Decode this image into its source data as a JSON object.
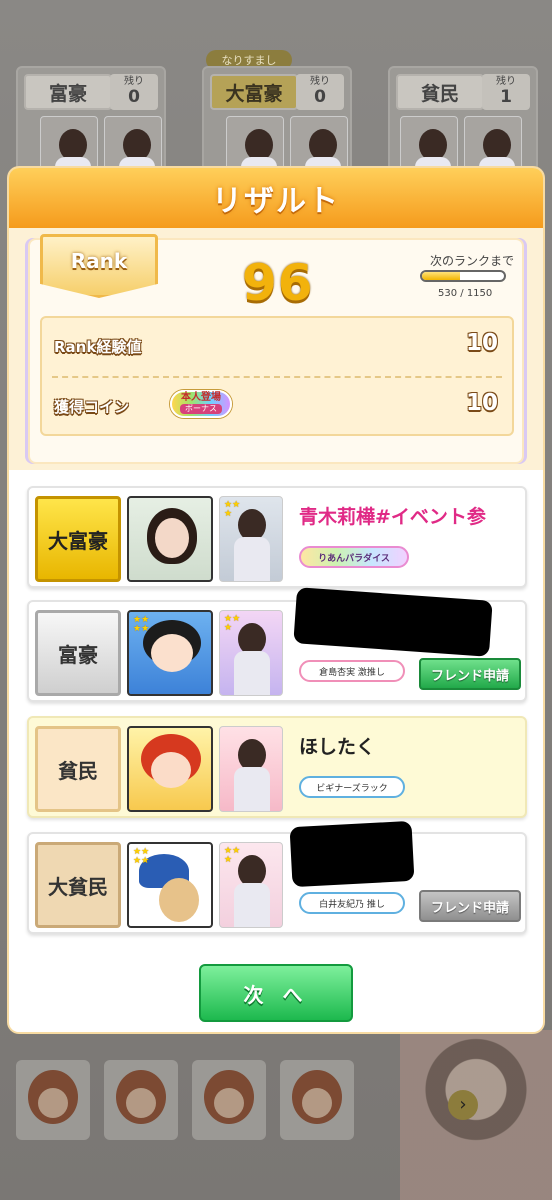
{
  "background": {
    "players": [
      {
        "rank": "富豪",
        "remaining_label": "残り",
        "remaining": "0"
      },
      {
        "rank": "大富豪",
        "remaining_label": "残り",
        "remaining": "0",
        "tag": "なりすまし"
      },
      {
        "rank": "貧民",
        "remaining_label": "残り",
        "remaining": "1"
      }
    ]
  },
  "modal": {
    "title": "リザルト",
    "rank_label": "Rank",
    "rank_value": "96",
    "next_rank_label": "次のランクまで",
    "progress_text": "530 / 1150",
    "progress": 0.46,
    "exp_label": "Rank経験値",
    "exp_value": "10",
    "coin_label": "獲得コイン",
    "coin_value": "10",
    "bonus_line1": "本人登場",
    "bonus_line2": "ボーナス"
  },
  "players": [
    {
      "title": "大富豪",
      "name": "青木莉樺#イベント参",
      "tag": "りあんパラダイス",
      "friend_button": ""
    },
    {
      "title": "富豪",
      "name": "",
      "tag": "倉島杏実 激推し",
      "friend_button": "フレンド申請"
    },
    {
      "title": "貧民",
      "name": "ほしたく",
      "tag": "ビギナーズラック",
      "friend_button": ""
    },
    {
      "title": "大貧民",
      "name": "",
      "tag": "白井友紀乃 推し",
      "friend_button": "フレンド申請"
    }
  ],
  "next_button": "次 へ",
  "colors": {
    "header": "#f59b1c",
    "rank_number": "#f2b20c",
    "friend_active": "#22a94a",
    "friend_disabled": "#8f8f8f",
    "next_button": "#1db94e"
  }
}
